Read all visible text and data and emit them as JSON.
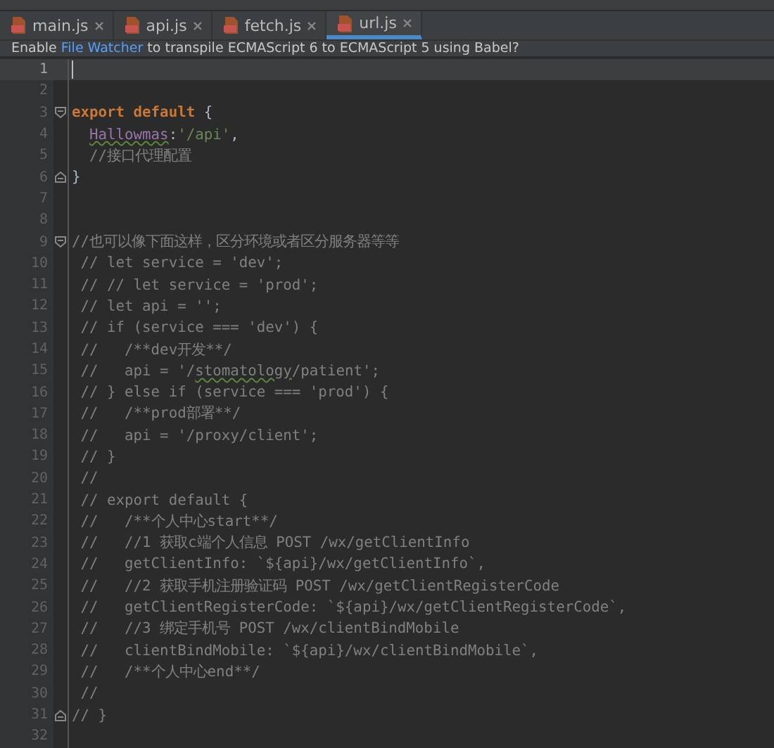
{
  "tabs": [
    {
      "label": "main.js",
      "selected": false
    },
    {
      "label": "api.js",
      "selected": false
    },
    {
      "label": "fetch.js",
      "selected": false
    },
    {
      "label": "url.js",
      "selected": true
    }
  ],
  "notification": {
    "before": "Enable ",
    "link": "File Watcher",
    "after": " to transpile ECMAScript 6 to ECMAScript 5 using Babel?"
  },
  "editor": {
    "lines": [
      {
        "number": "1",
        "current": true,
        "fold_start": false,
        "fold_end": false
      },
      {
        "number": "2",
        "current": false,
        "fold_start": false,
        "fold_end": false
      },
      {
        "number": "3",
        "current": false,
        "fold_start": true,
        "fold_end": false,
        "indent": false,
        "segments": [
          {
            "kind": "keyword",
            "text": "export default"
          },
          {
            "kind": "plain",
            "text": " {"
          }
        ]
      },
      {
        "number": "4",
        "current": false,
        "fold_start": false,
        "fold_end": false,
        "indent": true,
        "segments": [
          {
            "kind": "property",
            "text": "Hallowmas",
            "typo": true
          },
          {
            "kind": "plain",
            "text": ":"
          },
          {
            "kind": "string",
            "text": "'/api'"
          },
          {
            "kind": "plain",
            "text": ","
          }
        ]
      },
      {
        "number": "5",
        "current": false,
        "fold_start": false,
        "fold_end": false,
        "indent": true,
        "segments": [
          {
            "kind": "comment",
            "text": "//接口代理配置"
          }
        ]
      },
      {
        "number": "6",
        "current": false,
        "fold_start": false,
        "fold_end": true,
        "indent": false,
        "segments": [
          {
            "kind": "plain",
            "text": "}"
          }
        ]
      },
      {
        "number": "7",
        "current": false,
        "fold_start": false,
        "fold_end": false
      },
      {
        "number": "8",
        "current": false,
        "fold_start": false,
        "fold_end": false
      },
      {
        "number": "9",
        "current": false,
        "fold_start": true,
        "fold_end": false,
        "indent": false,
        "segments": [
          {
            "kind": "comment",
            "text": "//也可以像下面这样，区分环境或者区分服务器等等"
          }
        ]
      },
      {
        "number": "10",
        "current": false,
        "fold_start": false,
        "fold_end": false,
        "indent": false,
        "segments": [
          {
            "kind": "comment",
            "text": " // let service = 'dev';"
          }
        ]
      },
      {
        "number": "11",
        "current": false,
        "fold_start": false,
        "fold_end": false,
        "indent": false,
        "segments": [
          {
            "kind": "comment",
            "text": " // // let service = 'prod';"
          }
        ]
      },
      {
        "number": "12",
        "current": false,
        "fold_start": false,
        "fold_end": false,
        "indent": false,
        "segments": [
          {
            "kind": "comment",
            "text": " // let api = '';"
          }
        ]
      },
      {
        "number": "13",
        "current": false,
        "fold_start": false,
        "fold_end": false,
        "indent": false,
        "segments": [
          {
            "kind": "comment",
            "text": " // if (service === 'dev') {"
          }
        ]
      },
      {
        "number": "14",
        "current": false,
        "fold_start": false,
        "fold_end": false,
        "indent": false,
        "segments": [
          {
            "kind": "comment",
            "text": " //   /**dev开发**/"
          }
        ]
      },
      {
        "number": "15",
        "current": false,
        "fold_start": false,
        "fold_end": false,
        "indent": false,
        "segments": [
          {
            "kind": "comment",
            "text": " //   api = '/",
            "typo": false
          },
          {
            "kind": "comment",
            "text": "stomatology",
            "typo": true
          },
          {
            "kind": "comment",
            "text": "/patient';",
            "typo": false
          }
        ]
      },
      {
        "number": "16",
        "current": false,
        "fold_start": false,
        "fold_end": false,
        "indent": false,
        "segments": [
          {
            "kind": "comment",
            "text": " // } else if (service === 'prod') {"
          }
        ]
      },
      {
        "number": "17",
        "current": false,
        "fold_start": false,
        "fold_end": false,
        "indent": false,
        "segments": [
          {
            "kind": "comment",
            "text": " //   /**prod部署**/"
          }
        ]
      },
      {
        "number": "18",
        "current": false,
        "fold_start": false,
        "fold_end": false,
        "indent": false,
        "segments": [
          {
            "kind": "comment",
            "text": " //   api = '/proxy/client';"
          }
        ]
      },
      {
        "number": "19",
        "current": false,
        "fold_start": false,
        "fold_end": false,
        "indent": false,
        "segments": [
          {
            "kind": "comment",
            "text": " // }"
          }
        ]
      },
      {
        "number": "20",
        "current": false,
        "fold_start": false,
        "fold_end": false,
        "indent": false,
        "segments": [
          {
            "kind": "comment",
            "text": " //"
          }
        ]
      },
      {
        "number": "21",
        "current": false,
        "fold_start": false,
        "fold_end": false,
        "indent": false,
        "segments": [
          {
            "kind": "comment",
            "text": " // export default {"
          }
        ]
      },
      {
        "number": "22",
        "current": false,
        "fold_start": false,
        "fold_end": false,
        "indent": false,
        "segments": [
          {
            "kind": "comment",
            "text": " //   /**个人中心start**/"
          }
        ]
      },
      {
        "number": "23",
        "current": false,
        "fold_start": false,
        "fold_end": false,
        "indent": false,
        "segments": [
          {
            "kind": "comment",
            "text": " //   //1 获取c端个人信息 POST /wx/getClientInfo"
          }
        ]
      },
      {
        "number": "24",
        "current": false,
        "fold_start": false,
        "fold_end": false,
        "indent": false,
        "segments": [
          {
            "kind": "comment",
            "text": " //   getClientInfo: `${api}/wx/getClientInfo`,"
          }
        ]
      },
      {
        "number": "25",
        "current": false,
        "fold_start": false,
        "fold_end": false,
        "indent": false,
        "segments": [
          {
            "kind": "comment",
            "text": " //   //2 获取手机注册验证码 POST /wx/getClientRegisterCode"
          }
        ]
      },
      {
        "number": "26",
        "current": false,
        "fold_start": false,
        "fold_end": false,
        "indent": false,
        "segments": [
          {
            "kind": "comment",
            "text": " //   getClientRegisterCode: `${api}/wx/getClientRegisterCode`,"
          }
        ]
      },
      {
        "number": "27",
        "current": false,
        "fold_start": false,
        "fold_end": false,
        "indent": false,
        "segments": [
          {
            "kind": "comment",
            "text": " //   //3 绑定手机号 POST /wx/clientBindMobile"
          }
        ]
      },
      {
        "number": "28",
        "current": false,
        "fold_start": false,
        "fold_end": false,
        "indent": false,
        "segments": [
          {
            "kind": "comment",
            "text": " //   clientBindMobile: `${api}/wx/clientBindMobile`,"
          }
        ]
      },
      {
        "number": "29",
        "current": false,
        "fold_start": false,
        "fold_end": false,
        "indent": false,
        "segments": [
          {
            "kind": "comment",
            "text": " //   /**个人中心end**/"
          }
        ]
      },
      {
        "number": "30",
        "current": false,
        "fold_start": false,
        "fold_end": false,
        "indent": false,
        "segments": [
          {
            "kind": "comment",
            "text": " //"
          }
        ]
      },
      {
        "number": "31",
        "current": false,
        "fold_start": false,
        "fold_end": true,
        "indent": false,
        "segments": [
          {
            "kind": "comment",
            "text": "// }"
          }
        ]
      },
      {
        "number": "32",
        "current": false,
        "fold_start": false,
        "fold_end": false
      }
    ]
  }
}
